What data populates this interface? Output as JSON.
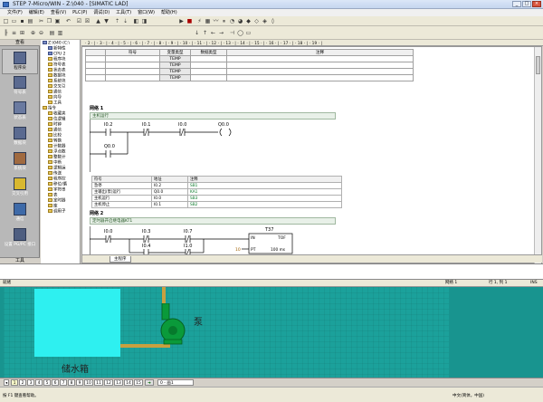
{
  "window": {
    "title": "STEP 7-Micro/WIN - Z:\\040 - [SIMATIC LAD]",
    "min": "_",
    "max": "□",
    "close": "×"
  },
  "menu": [
    "文件(F)",
    "编辑(E)",
    "查看(V)",
    "PLC(P)",
    "调试(D)",
    "工具(T)",
    "窗口(W)",
    "帮助(H)"
  ],
  "nav": {
    "header": "查看",
    "footer": "工具",
    "items": [
      {
        "label": "程序块",
        "icon": "program-block-icon"
      },
      {
        "label": "符号表",
        "icon": "symbol-table-icon"
      },
      {
        "label": "状态表",
        "icon": "status-table-icon"
      },
      {
        "label": "数据块",
        "icon": "data-block-icon"
      },
      {
        "label": "系统块",
        "icon": "system-block-icon"
      },
      {
        "label": "交叉引用",
        "icon": "cross-reference-icon"
      },
      {
        "label": "通信",
        "icon": "communication-icon"
      },
      {
        "label": "设置 PG/PC 接口",
        "icon": "pgpc-interface-icon"
      }
    ]
  },
  "tree": {
    "items": [
      {
        "label": "Z:\\040 (C:\\",
        "folder": false
      },
      {
        "label": "新特性",
        "folder": false
      },
      {
        "label": "CPU 2",
        "folder": false
      },
      {
        "label": "程序块",
        "folder": true
      },
      {
        "label": "符号表",
        "folder": true
      },
      {
        "label": "状态表",
        "folder": true
      },
      {
        "label": "数据块",
        "folder": true
      },
      {
        "label": "系统块",
        "folder": true
      },
      {
        "label": "交叉引",
        "folder": true
      },
      {
        "label": "通信",
        "folder": true
      },
      {
        "label": "向导",
        "folder": true
      },
      {
        "label": "工具",
        "folder": true
      },
      {
        "label": "指令",
        "folder": true
      },
      {
        "label": "收藏夹",
        "folder": true
      },
      {
        "label": "位逻辑",
        "folder": true
      },
      {
        "label": "时钟",
        "folder": true
      },
      {
        "label": "通信",
        "folder": true
      },
      {
        "label": "比较",
        "folder": true
      },
      {
        "label": "转换",
        "folder": true
      },
      {
        "label": "计数器",
        "folder": true
      },
      {
        "label": "浮点数",
        "folder": true
      },
      {
        "label": "整数计",
        "folder": true
      },
      {
        "label": "中断",
        "folder": true
      },
      {
        "label": "逻辑运",
        "folder": true
      },
      {
        "label": "传送",
        "folder": true
      },
      {
        "label": "程序控",
        "folder": true
      },
      {
        "label": "移位/循",
        "folder": true
      },
      {
        "label": "字符串",
        "folder": true
      },
      {
        "label": "表",
        "folder": true
      },
      {
        "label": "定时器",
        "folder": true
      },
      {
        "label": "库",
        "folder": true
      },
      {
        "label": "调用子",
        "folder": true
      }
    ]
  },
  "ruler": "· 2 · | · 3 · | · 4 · | · 5 · | · 6 · | · 7 · | · 8 · | · 9 · | · 10 · | · 11 · | · 12 · | · 13 · | · 14 · | · 15 · | · 16 · | · 17 · | · 18 · | · 19 · |",
  "var_table": {
    "headers": [
      "",
      "符号",
      "变量类型",
      "数据类型",
      "注释"
    ],
    "rows": [
      [
        "",
        "",
        "TEMP",
        "",
        ""
      ],
      [
        "",
        "",
        "TEMP",
        "",
        ""
      ],
      [
        "",
        "",
        "TEMP",
        "",
        ""
      ],
      [
        "",
        "",
        "TEMP",
        "",
        ""
      ]
    ]
  },
  "network1": {
    "title": "网络 1",
    "comment": "主机运行",
    "contacts": [
      "I0.2",
      "I0.1",
      "I0.0",
      "Q0.0",
      "Q0.0"
    ],
    "symbols": {
      "headers": [
        "符号",
        "地址",
        "注释"
      ],
      "rows": [
        [
          "急停",
          "I0.2",
          "SB1"
        ],
        [
          "主输出(泵)运行",
          "Q0.0",
          "KA1"
        ],
        [
          "主机运行",
          "I0.0",
          "SB3"
        ],
        [
          "主机停止",
          "I0.1",
          "SB2"
        ]
      ]
    }
  },
  "network2": {
    "title": "网络 2",
    "comment": "定时器开启继电器KT1",
    "contacts": [
      "I0.0",
      "I0.3",
      "I0.7",
      "I0.4",
      "I1.0"
    ],
    "timer": {
      "name": "T37",
      "type": "TOF",
      "in": "IN",
      "pt": "PT",
      "preset": "10",
      "unit": "100 ms"
    }
  },
  "editor_tab": "主程序",
  "status": {
    "ready": "就绪",
    "network": "网络 1",
    "position": "行 1, 列 1",
    "mode": "INS"
  },
  "hmi": {
    "tank_label": "储水箱",
    "pump_label": "泵",
    "pages": [
      "1",
      "2",
      "3",
      "4",
      "5",
      "6",
      "7",
      "8",
      "9",
      "10",
      "11",
      "12",
      "13",
      "14",
      "15"
    ],
    "screen_select": "0 - 画1"
  },
  "bottom_status": {
    "hint": "按 F1 键查看帮助。",
    "ime": "中文(简体，中国)"
  }
}
